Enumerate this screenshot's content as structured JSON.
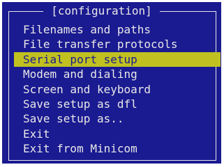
{
  "window": {
    "title": "[configuration]"
  },
  "menu": {
    "items": [
      {
        "label": "Filenames and paths",
        "selected": false
      },
      {
        "label": "File transfer protocols",
        "selected": false
      },
      {
        "label": "Serial port setup",
        "selected": true
      },
      {
        "label": "Modem and dialing",
        "selected": false
      },
      {
        "label": "Screen and keyboard",
        "selected": false
      },
      {
        "label": "Save setup as dfl",
        "selected": false
      },
      {
        "label": "Save setup as..",
        "selected": false
      },
      {
        "label": "Exit",
        "selected": false
      },
      {
        "label": "Exit from Minicom",
        "selected": false
      }
    ]
  },
  "colors": {
    "background": "#1a1a91",
    "text": "#e8e8e8",
    "highlight": "#c0c121",
    "highlight_text": "#1a1a91"
  }
}
